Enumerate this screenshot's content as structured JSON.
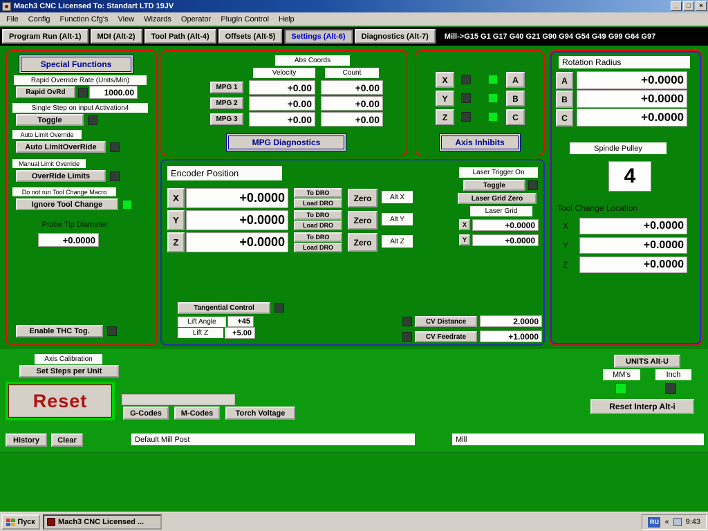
{
  "window": {
    "title": "Mach3 CNC  Licensed To: Standart LTD 19JV",
    "minimize": "_",
    "maximize": "□",
    "close": "×"
  },
  "menu": {
    "items": [
      "File",
      "Config",
      "Function Cfg's",
      "View",
      "Wizards",
      "Operator",
      "PlugIn Control",
      "Help"
    ]
  },
  "tabs": {
    "program_run": "Program Run (Alt-1)",
    "mdi": "MDI (Alt-2)",
    "tool_path": "Tool Path (Alt-4)",
    "offsets": "Offsets (Alt-5)",
    "settings": "Settings (Alt-6)",
    "diagnostics": "Diagnostics (Alt-7)",
    "modal_status": "Mill->G15 G1 G17 G40 G21 G90 G94 G54 G49 G99 G64 G97"
  },
  "special": {
    "header": "Special Functions",
    "rapid_label": "Rapid Override Rate (Units/Min)",
    "rapid_btn": "Rapid OvRd",
    "rapid_value": "1000.00",
    "single_step_label": "Single Step on input Activation4",
    "toggle_btn": "Toggle",
    "auto_limit_label": "Auto Limit Override",
    "auto_limit_btn": "Auto LimitOverRide",
    "manual_limit_label": "Manual Limit Override",
    "override_btn": "OverRide Limits",
    "tool_change_label": "Do not run Tool Change Macro",
    "ignore_tool_btn": "Ignore Tool Change",
    "probe_label": "Probe Tip Diameter",
    "probe_value": "+0.0000",
    "thc_btn": "Enable THC Tog."
  },
  "mpg": {
    "abs_coords": "Abs Coords",
    "velocity": "Velocity",
    "count": "Count",
    "rows": [
      {
        "label": "MPG 1",
        "velocity": "+0.00",
        "count": "+0.00"
      },
      {
        "label": "MPG 2",
        "velocity": "+0.00",
        "count": "+0.00"
      },
      {
        "label": "MPG 3",
        "velocity": "+0.00",
        "count": "+0.00"
      }
    ],
    "diagnostics": "MPG Diagnostics"
  },
  "axis_inhibits": {
    "left": [
      "X",
      "Y",
      "Z"
    ],
    "right": [
      "A",
      "B",
      "C"
    ],
    "title": "Axis Inhibits"
  },
  "rotation": {
    "title": "Rotation Radius",
    "rows": [
      {
        "axis": "A",
        "value": "+0.0000"
      },
      {
        "axis": "B",
        "value": "+0.0000"
      },
      {
        "axis": "C",
        "value": "+0.0000"
      }
    ],
    "spindle_pulley": "Spindle Pulley",
    "pulley_value": "4",
    "tool_change_title": "Tool Change Location",
    "tool_rows": [
      {
        "axis": "X",
        "value": "+0.0000"
      },
      {
        "axis": "Y",
        "value": "+0.0000"
      },
      {
        "axis": "Z",
        "value": "+0.0000"
      }
    ]
  },
  "encoder": {
    "title": "Encoder Position",
    "rows": [
      {
        "axis": "X",
        "value": "+0.0000",
        "to_dro": "To DRO",
        "load_dro": "Load DRO",
        "zero": "Zero",
        "alt": "Alt X"
      },
      {
        "axis": "Y",
        "value": "+0.0000",
        "to_dro": "To DRO",
        "load_dro": "Load DRO",
        "zero": "Zero",
        "alt": "Alt Y"
      },
      {
        "axis": "Z",
        "value": "+0.0000",
        "to_dro": "To DRO",
        "load_dro": "Load DRO",
        "zero": "Zero",
        "alt": "Alt Z"
      }
    ],
    "laser": {
      "trigger_label": "Laser Trigger On",
      "toggle_btn": "Toggle",
      "grid_zero_btn": "Laser Grid Zero",
      "grid_label": "Laser Grid",
      "x_label": "X",
      "x_value": "+0.0000",
      "y_label": "Y",
      "y_value": "+0.0000"
    },
    "tangential": {
      "btn": "Tangential Control",
      "lift_angle_label": "Lift Angle",
      "lift_angle_value": "+45",
      "lift_z_label": "Lift Z",
      "lift_z_value": "+5.00"
    },
    "cv": [
      {
        "label": "CV Distance",
        "value": "2.0000"
      },
      {
        "label": "CV Feedrate",
        "value": "+1.0000"
      }
    ]
  },
  "bottom": {
    "axis_cal_label": "Axis Calibration",
    "set_steps_btn": "Set Steps per Unit",
    "reset_btn": "Reset",
    "gcodes_btn": "G-Codes",
    "mcodes_btn": "M-Codes",
    "torch_btn": "Torch Voltage",
    "units_btn": "UNITS Alt-U",
    "mms_label": "MM's",
    "inch_label": "Inch",
    "reset_interp_btn": "Reset Interp Alt-i",
    "history_btn": "History",
    "clear_btn": "Clear",
    "post_value": "Default Mill Post",
    "profile_value": "Mill"
  },
  "taskbar": {
    "start": "Пуск",
    "task": "Mach3 CNC  Licensed ...",
    "lang": "RU",
    "clock": "9:43"
  }
}
